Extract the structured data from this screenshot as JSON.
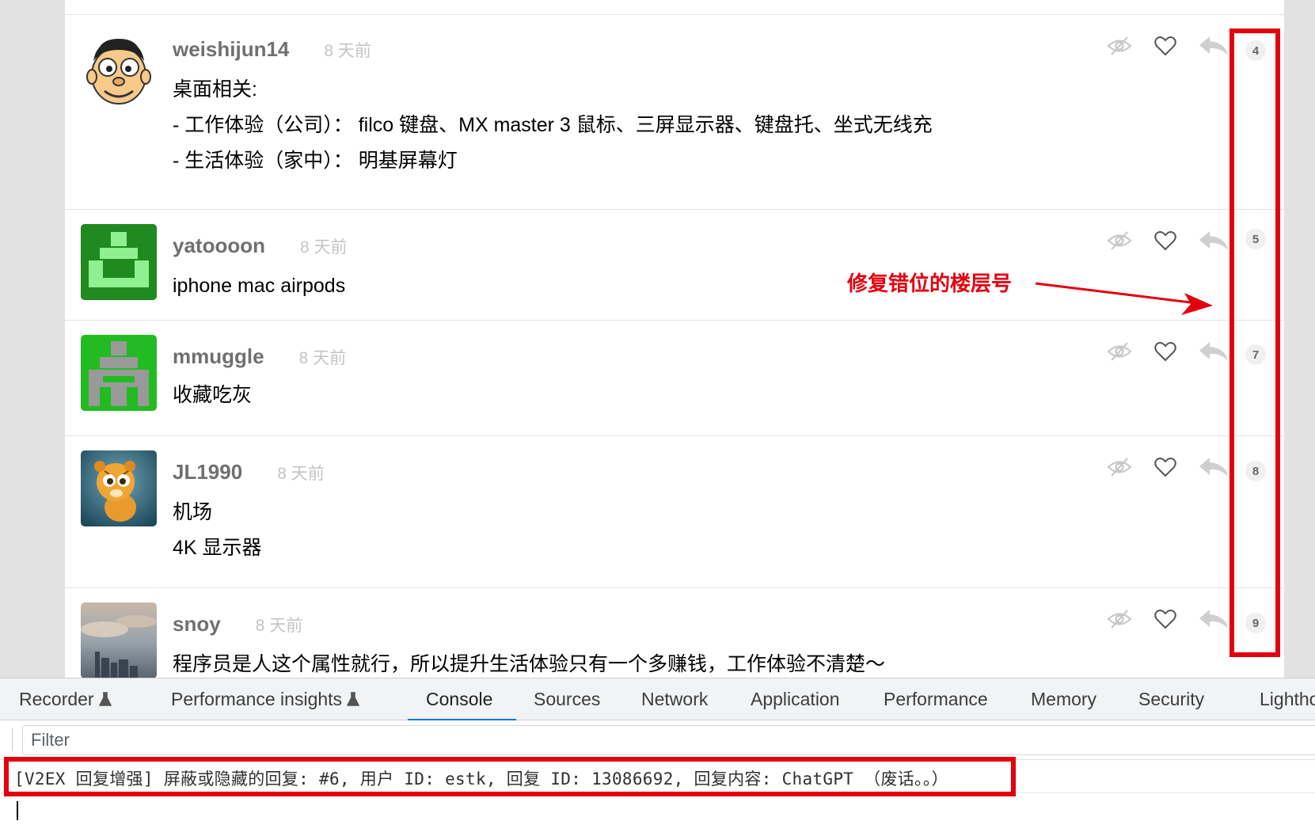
{
  "replies": [
    {
      "username": "weishijun14",
      "time_ago": "8 天前",
      "floor": "4",
      "content": [
        "桌面相关:",
        "- 工作体验（公司）： filco 键盘、MX master 3 鼠标、三屏显示器、键盘托、坐式无线充",
        "- 生活体验（家中）： 明基屏幕灯"
      ],
      "avatar": "cartoon-face-avatar"
    },
    {
      "username": "yatoooon",
      "time_ago": "8 天前",
      "floor": "5",
      "content": [
        "iphone mac airpods"
      ],
      "avatar": "green-identicon-avatar"
    },
    {
      "username": "mmuggle",
      "time_ago": "8 天前",
      "floor": "7",
      "content": [
        "收藏吃灰"
      ],
      "avatar": "green-gray-identicon-avatar"
    },
    {
      "username": "JL1990",
      "time_ago": "8 天前",
      "floor": "8",
      "content": [
        "机场",
        "4K 显示器"
      ],
      "avatar": "tiger-cub-avatar"
    },
    {
      "username": "snoy",
      "time_ago": "8 天前",
      "floor": "9",
      "content": [
        "程序员是人这个属性就行，所以提升生活体验只有一个多赚钱，工作体验不清楚～"
      ],
      "avatar": "city-skyline-avatar"
    }
  ],
  "actions": {
    "hide_icon": "eye-slash-icon",
    "thank_icon": "heart-icon",
    "reply_icon": "reply-arrow-icon"
  },
  "annotation": {
    "text": "修复错位的楼层号",
    "color": "#e3000f"
  },
  "devtools": {
    "tabs": [
      {
        "label": "Recorder",
        "icon": "flask-icon"
      },
      {
        "label": "Performance insights",
        "icon": "flask-icon"
      },
      {
        "label": "Console",
        "active": true
      },
      {
        "label": "Sources"
      },
      {
        "label": "Network"
      },
      {
        "label": "Application"
      },
      {
        "label": "Performance"
      },
      {
        "label": "Memory"
      },
      {
        "label": "Security"
      },
      {
        "label": "Lighthouse"
      }
    ],
    "filter_placeholder": "Filter",
    "console_message": "[V2EX 回复增强] 屏蔽或隐藏的回复: #6, 用户 ID: estk, 回复 ID: 13086692, 回复内容: ChatGPT （废话。。）",
    "accent_color": "#1a73e8"
  }
}
